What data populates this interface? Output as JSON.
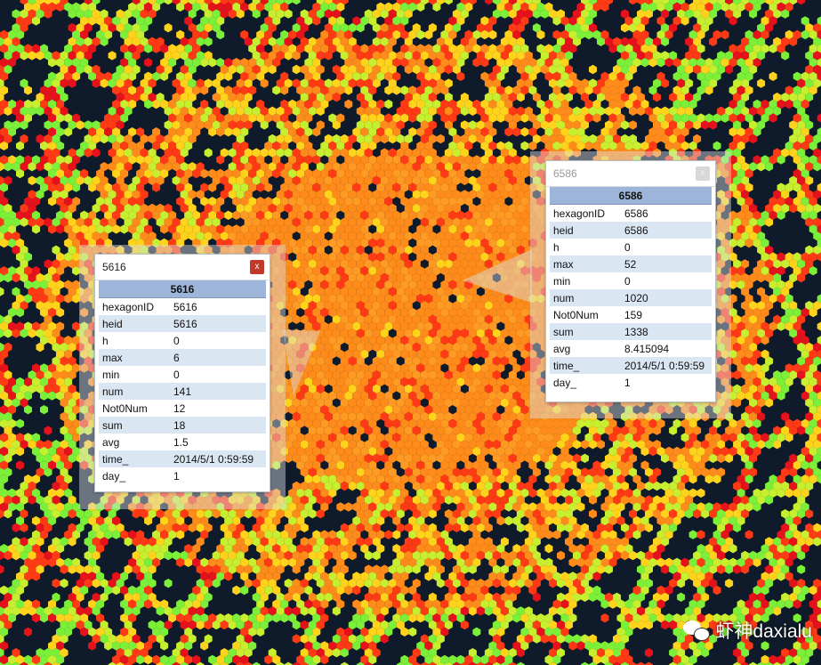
{
  "map": {
    "colors": {
      "background": "#0f1b2a",
      "low": "#7cf038",
      "lowmid": "#c8ee30",
      "mid": "#ffd21c",
      "midhigh": "#ff8c1a",
      "high": "#ff3a14",
      "peak": "#e5121c",
      "center": "#ff9a22"
    }
  },
  "popups": [
    {
      "id": "5616",
      "title": "5616",
      "header": "5616",
      "rows": [
        {
          "key": "hexagonID",
          "value": "5616"
        },
        {
          "key": "heid",
          "value": "5616"
        },
        {
          "key": "h",
          "value": "0"
        },
        {
          "key": "max",
          "value": "6"
        },
        {
          "key": "min",
          "value": "0"
        },
        {
          "key": "num",
          "value": "141"
        },
        {
          "key": "Not0Num",
          "value": "12"
        },
        {
          "key": "sum",
          "value": "18"
        },
        {
          "key": "avg",
          "value": "1.5"
        },
        {
          "key": "time_",
          "value": "2014/5/1 0:59:59"
        },
        {
          "key": "day_",
          "value": "1"
        }
      ],
      "close_label": "x"
    },
    {
      "id": "6586",
      "title": "6586",
      "header": "6586",
      "rows": [
        {
          "key": "hexagonID",
          "value": "6586"
        },
        {
          "key": "heid",
          "value": "6586"
        },
        {
          "key": "h",
          "value": "0"
        },
        {
          "key": "max",
          "value": "52"
        },
        {
          "key": "min",
          "value": "0"
        },
        {
          "key": "num",
          "value": "1020"
        },
        {
          "key": "Not0Num",
          "value": "159"
        },
        {
          "key": "sum",
          "value": "1338"
        },
        {
          "key": "avg",
          "value": "8.415094"
        },
        {
          "key": "time_",
          "value": "2014/5/1 0:59:59"
        },
        {
          "key": "day_",
          "value": "1"
        }
      ],
      "close_label": "x"
    }
  ],
  "watermark": {
    "text": "虾神daxialu",
    "icon": "wechat-icon"
  }
}
